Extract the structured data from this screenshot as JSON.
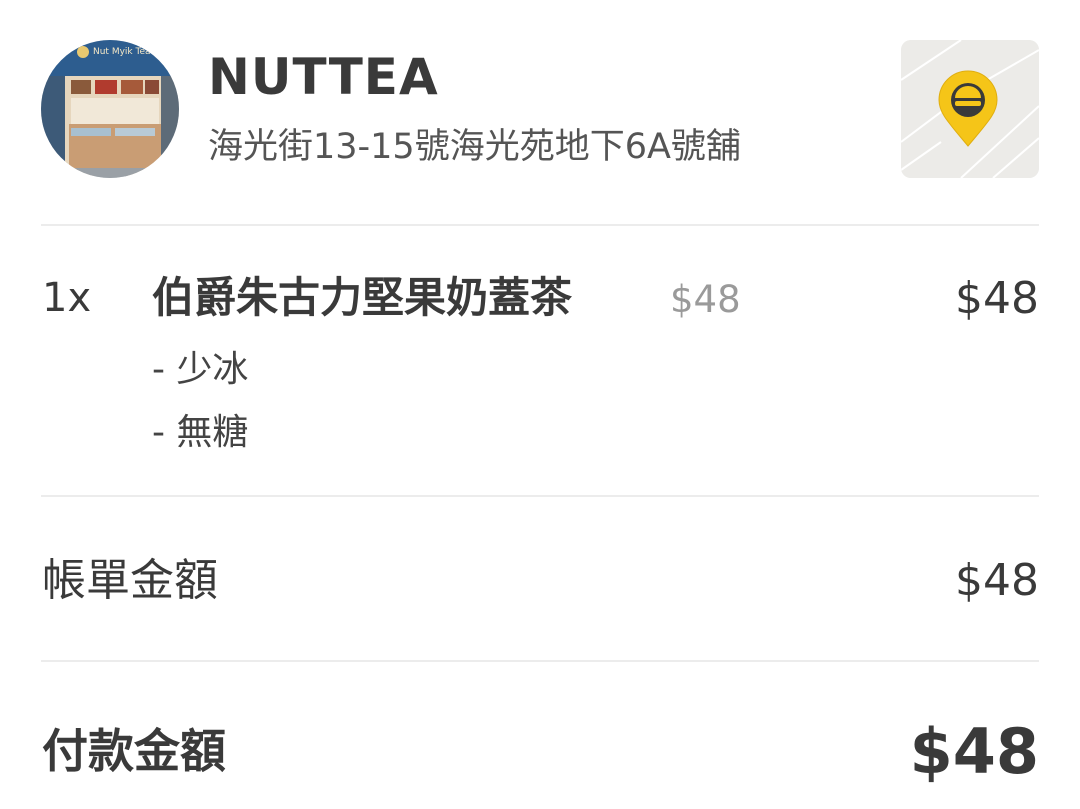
{
  "store": {
    "name": "NUTTEA",
    "address": "海光街13-15號海光苑地下6A號舖",
    "avatar_sign_text": "Nut Myik Tea",
    "map_pin_color": "#f5c518",
    "icons": {
      "avatar": "storefront-photo",
      "map": "map-pin-icon"
    }
  },
  "order": {
    "items": [
      {
        "quantity": "1x",
        "name": "伯爵朱古力堅果奶蓋茶",
        "unit_price": "$48",
        "total": "$48",
        "options": [
          "- 少冰",
          "- 無糖"
        ]
      }
    ]
  },
  "summary": {
    "bill_label": "帳單金額",
    "bill_amount": "$48",
    "payment_label": "付款金額",
    "payment_amount": "$48"
  }
}
